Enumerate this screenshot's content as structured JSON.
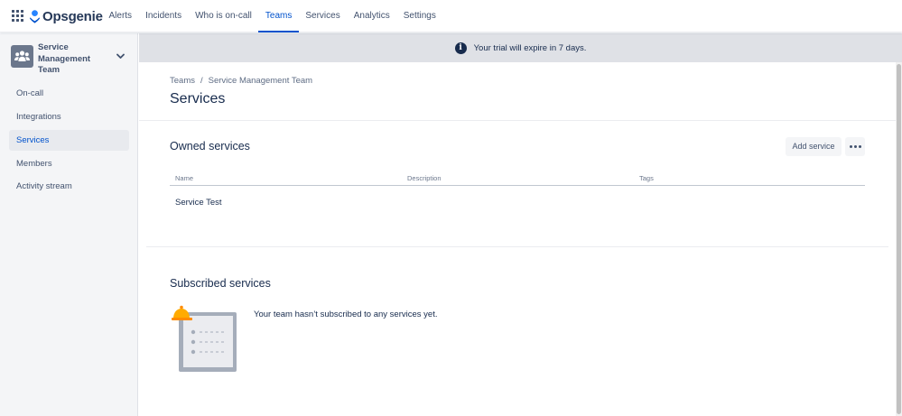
{
  "topnav": {
    "app_switcher_icon": "grid-icon",
    "logo_text": "Opsgenie",
    "items": [
      {
        "label": "Alerts",
        "active": false
      },
      {
        "label": "Incidents",
        "active": false
      },
      {
        "label": "Who is on-call",
        "active": false
      },
      {
        "label": "Teams",
        "active": true
      },
      {
        "label": "Services",
        "active": false
      },
      {
        "label": "Analytics",
        "active": false
      },
      {
        "label": "Settings",
        "active": false
      }
    ]
  },
  "sidebar": {
    "team": {
      "name": "Service Management Team",
      "icon": "team-icon"
    },
    "items": [
      {
        "label": "On-call"
      },
      {
        "label": "Integrations"
      },
      {
        "label": "Services",
        "selected": true
      },
      {
        "label": "Members"
      },
      {
        "label": "Activity stream"
      }
    ]
  },
  "banner": {
    "icon": "info-icon",
    "text": "Your trial will expire in 7 days."
  },
  "breadcrumb": {
    "items": [
      "Teams",
      "Service Management Team"
    ],
    "separator": "/"
  },
  "page": {
    "title": "Services"
  },
  "owned": {
    "title": "Owned services",
    "add_label": "Add service",
    "columns": [
      "Name",
      "Description",
      "Tags"
    ],
    "rows": [
      {
        "name": "Service Test",
        "description": "",
        "tags": ""
      }
    ]
  },
  "subscribed": {
    "title": "Subscribed services",
    "empty_text": "Your team hasn’t subscribed to any services yet."
  },
  "colors": {
    "accent": "#0052cc",
    "text": "#172b4d",
    "sidebar_bg": "#f4f5f7",
    "banner_bg": "#dfe1e6"
  }
}
